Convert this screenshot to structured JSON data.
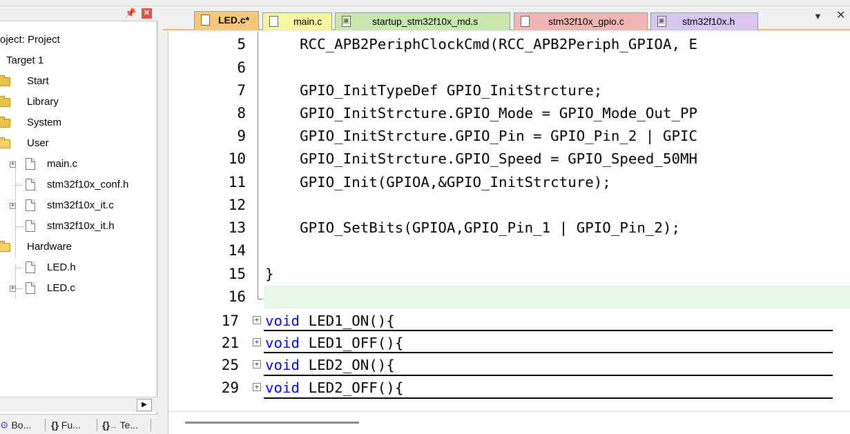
{
  "project_panel": {
    "title": "oject: Project",
    "target": "Target 1",
    "groups": [
      {
        "label": "Start"
      },
      {
        "label": "Library"
      },
      {
        "label": "System"
      },
      {
        "label": "User",
        "files": [
          "main.c",
          "stm32f10x_conf.h",
          "stm32f10x_it.c",
          "stm32f10x_it.h"
        ]
      },
      {
        "label": "Hardware",
        "files": [
          "LED.h",
          "LED.c"
        ]
      }
    ],
    "bottom_tabs": [
      "Bo...",
      "Fu...",
      "Te..."
    ]
  },
  "editor_tabs": [
    {
      "label": "LED.c*",
      "color": "#f7c878",
      "icon": "c-file-icon"
    },
    {
      "label": "main.c",
      "color": "#f6f6a0",
      "icon": "c-file-icon"
    },
    {
      "label": "startup_stm32f10x_md.s",
      "color": "#c8e6b0",
      "icon": "asm-file-icon"
    },
    {
      "label": "stm32f10x_gpio.c",
      "color": "#f2b6b6",
      "icon": "c-file-icon"
    },
    {
      "label": "stm32f10x.h",
      "color": "#d6c6f0",
      "icon": "header-file-icon"
    }
  ],
  "editor": {
    "lines": [
      {
        "num": "5",
        "code": "    RCC_APB2PeriphClockCmd(RCC_APB2Periph_GPIOA, E"
      },
      {
        "num": "6",
        "code": ""
      },
      {
        "num": "7",
        "code": "    GPIO_InitTypeDef GPIO_InitStrcture;"
      },
      {
        "num": "8",
        "code": "    GPIO_InitStrcture.GPIO_Mode = GPIO_Mode_Out_PP"
      },
      {
        "num": "9",
        "code": "    GPIO_InitStrcture.GPIO_Pin = GPIO_Pin_2 | GPIC"
      },
      {
        "num": "10",
        "code": "    GPIO_InitStrcture.GPIO_Speed = GPIO_Speed_50MH"
      },
      {
        "num": "11",
        "code": "    GPIO_Init(GPIOA,&GPIO_InitStrcture);"
      },
      {
        "num": "12",
        "code": ""
      },
      {
        "num": "13",
        "code": "    GPIO_SetBits(GPIOA,GPIO_Pin_1 | GPIO_Pin_2);"
      },
      {
        "num": "14",
        "code": ""
      },
      {
        "num": "15",
        "code": "}"
      },
      {
        "num": "16",
        "code": ""
      }
    ],
    "folded": [
      {
        "num": "17",
        "keyword": "void",
        "rest": " LED1_ON(){"
      },
      {
        "num": "21",
        "keyword": "void",
        "rest": " LED1_OFF(){"
      },
      {
        "num": "25",
        "keyword": "void",
        "rest": " LED2_ON(){"
      },
      {
        "num": "29",
        "keyword": "void",
        "rest": " LED2_OFF(){"
      }
    ]
  }
}
